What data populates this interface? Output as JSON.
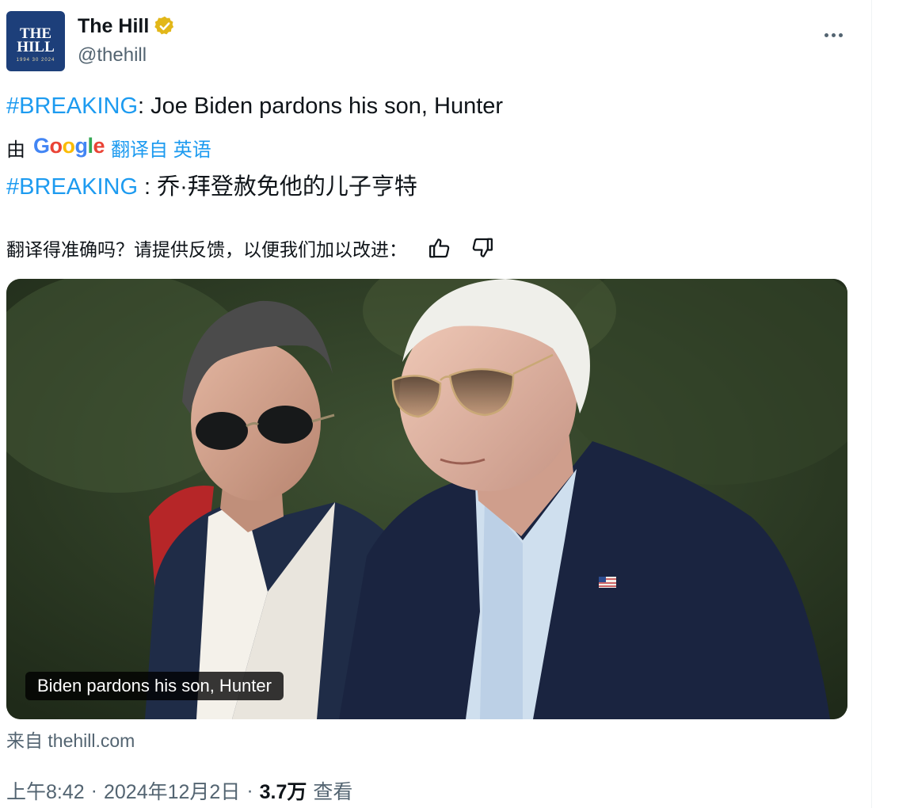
{
  "account": {
    "display_name": "The Hill",
    "handle": "@thehill",
    "avatar": {
      "line1": "THE",
      "line2": "HILL",
      "years": "1994  30  2024"
    },
    "verified_icon": "verified-badge-gold"
  },
  "tweet": {
    "hashtag": "#BREAKING",
    "text": ": Joe Biden pardons his son, Hunter"
  },
  "translation": {
    "by_prefix": "由",
    "provider": {
      "G": "G",
      "o1": "o",
      "o2": "o",
      "g": "g",
      "l": "l",
      "e": "e"
    },
    "link_label": "翻译自 英语",
    "hashtag": "#BREAKING",
    "text": " : 乔·拜登赦免他的儿子亨特",
    "feedback_prompt": "翻译得准确吗？请提供反馈，以便我们加以改进：",
    "feedback_icons": [
      "thumbs-up-icon",
      "thumbs-down-icon"
    ]
  },
  "media": {
    "caption": "Biden pardons his son, Hunter",
    "source": "来自 thehill.com"
  },
  "meta": {
    "time": "上午8:42",
    "separator": "·",
    "date": "2024年12月2日",
    "views_count": "3.7万",
    "views_label": "查看"
  },
  "colors": {
    "link": "#1d9bf0",
    "text_primary": "#0f1419",
    "text_secondary": "#536471",
    "verified_gold": "#e2b719"
  }
}
